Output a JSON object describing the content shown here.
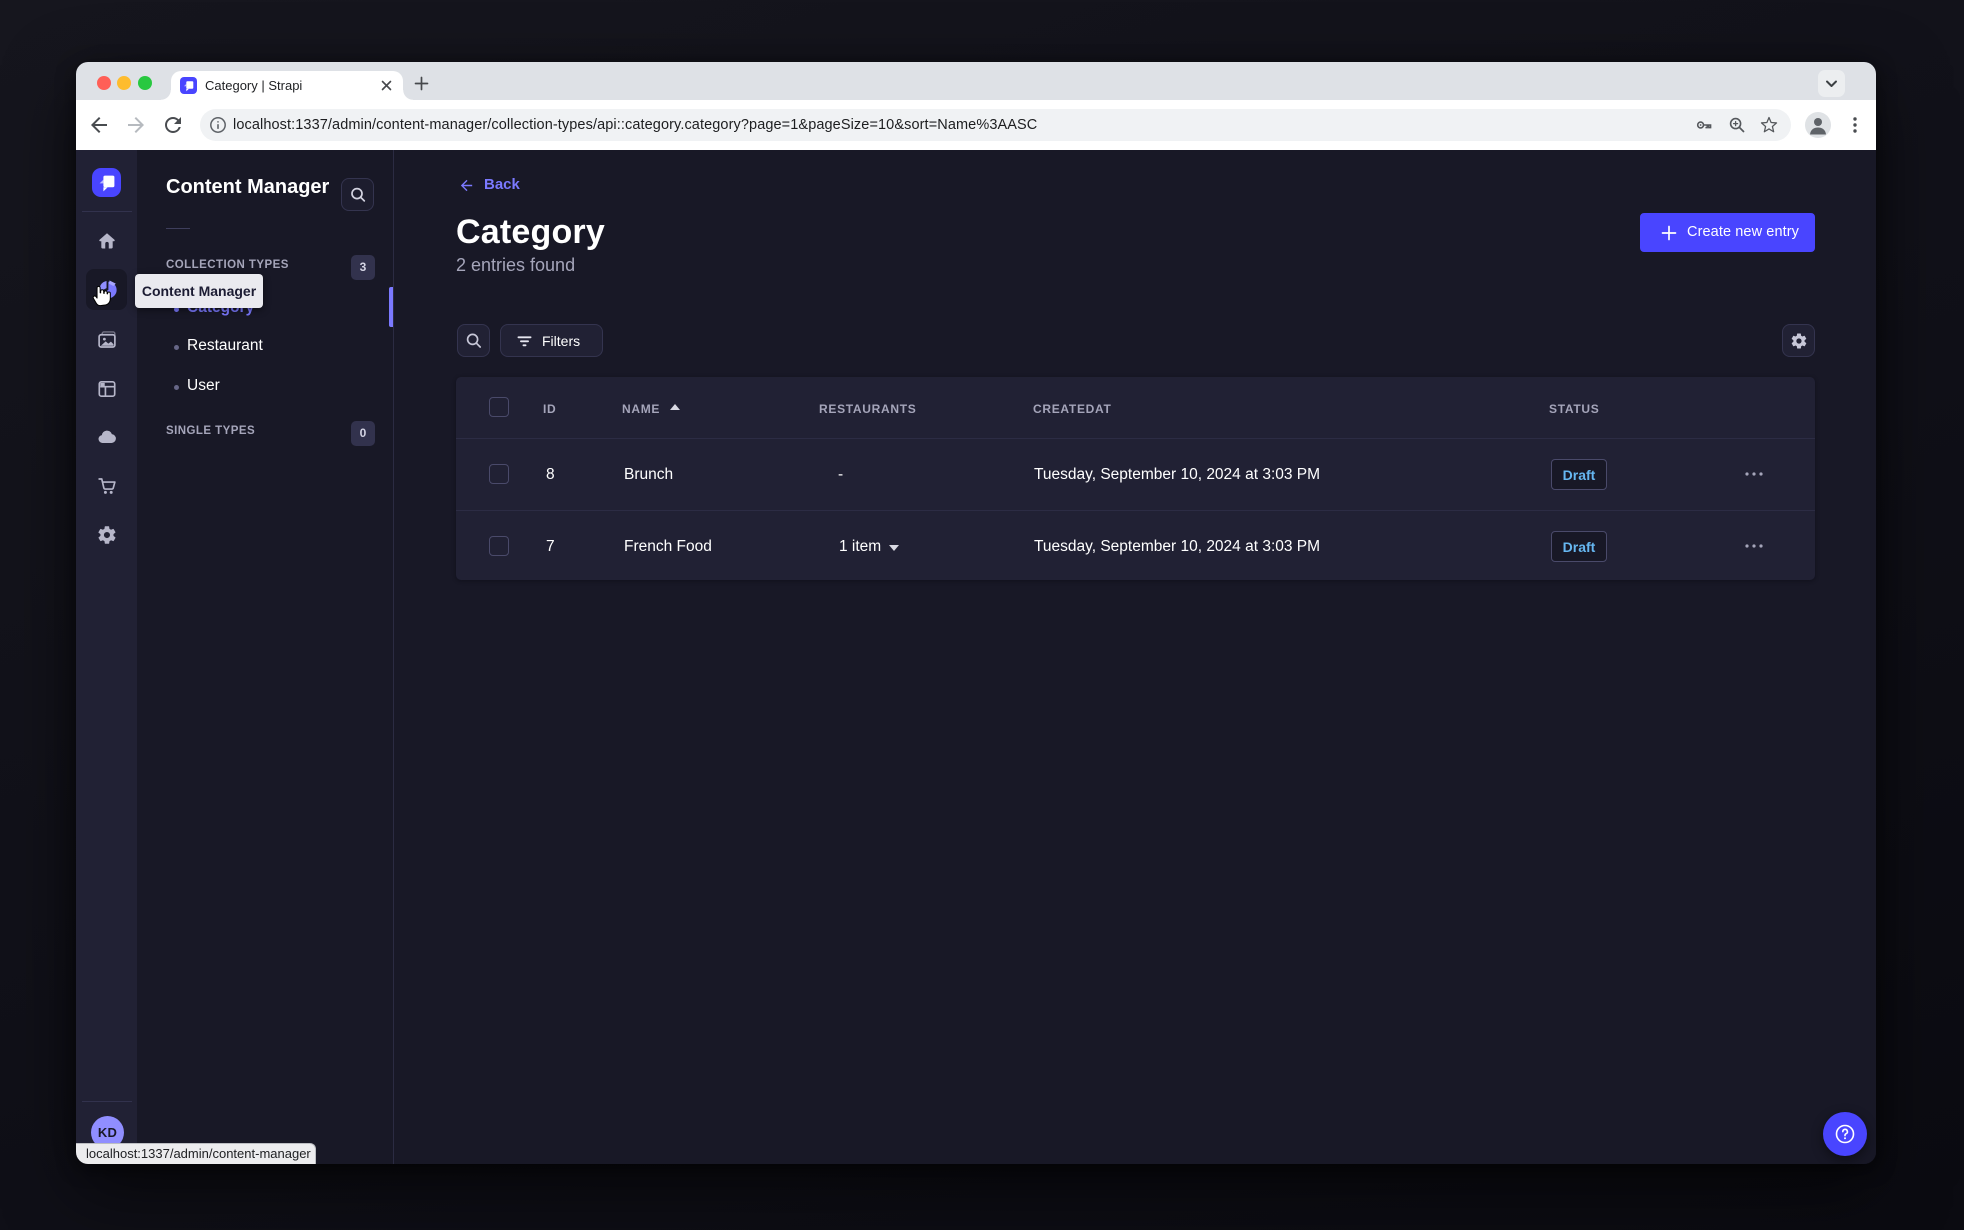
{
  "browser": {
    "tab_title": "Category | Strapi",
    "url": "localhost:1337/admin/content-manager/collection-types/api::category.category?page=1&pageSize=10&sort=Name%3AASC",
    "status_bubble_url": "localhost:1337/admin/content-manager"
  },
  "sidebar": {
    "title": "Content Manager",
    "tooltip": "Content Manager",
    "collection_types": {
      "label": "COLLECTION TYPES",
      "count": "3"
    },
    "items": [
      {
        "label": "Category"
      },
      {
        "label": "Restaurant"
      },
      {
        "label": "User"
      }
    ],
    "single_types": {
      "label": "SINGLE TYPES",
      "count": "0"
    },
    "avatar_initials": "KD"
  },
  "main": {
    "back_label": "Back",
    "title": "Category",
    "subtitle": "2 entries found",
    "create_button_label": "Create new entry",
    "filters_button_label": "Filters",
    "table": {
      "headers": {
        "id": "ID",
        "name": "NAME",
        "restaurants": "RESTAURANTS",
        "createdat": "CREATEDAT",
        "status": "STATUS"
      },
      "rows": [
        {
          "id": "8",
          "name": "Brunch",
          "restaurants": "-",
          "created_at": "Tuesday, September 10, 2024 at 3:03 PM",
          "status": "Draft"
        },
        {
          "id": "7",
          "name": "French Food",
          "restaurants": "1 item",
          "created_at": "Tuesday, September 10, 2024 at 3:03 PM",
          "status": "Draft"
        }
      ]
    }
  },
  "colors": {
    "primary": "#4945ff",
    "primary_light": "#7b79ff",
    "app_background": "#181826",
    "card_background": "#212134",
    "draft_text": "#66b7f1"
  }
}
